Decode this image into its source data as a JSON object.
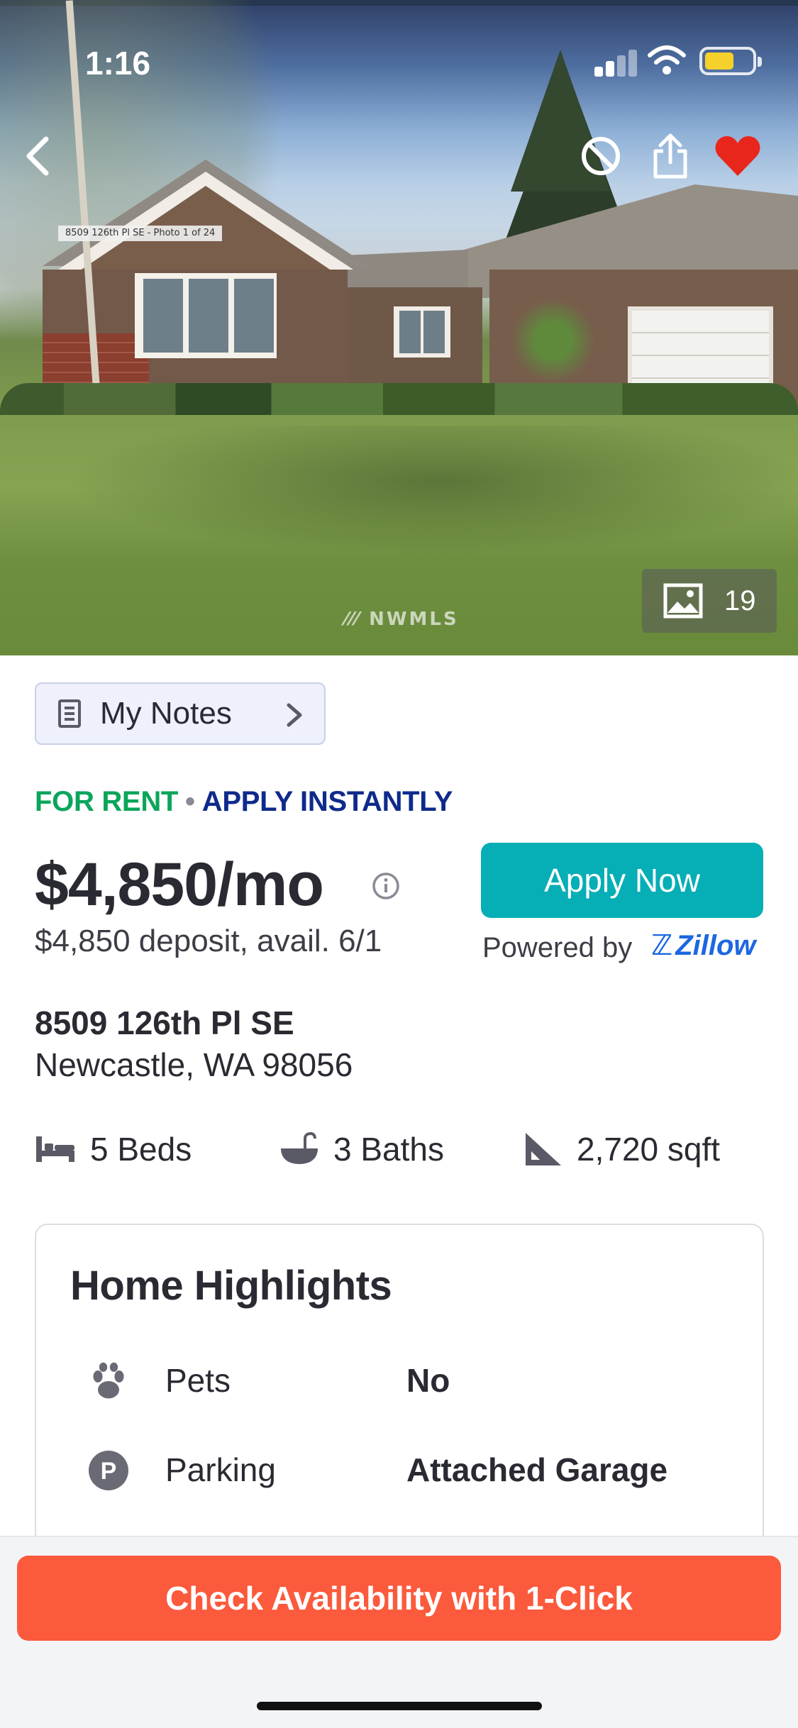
{
  "status_bar": {
    "time": "1:16"
  },
  "hero": {
    "photo_tag": "8509 126th Pl SE - Photo 1 of 24",
    "watermark": "NWMLS",
    "photo_count": "19"
  },
  "notes": {
    "label": "My Notes"
  },
  "listing": {
    "status": "FOR RENT",
    "separator": "•",
    "apply_tag": "APPLY INSTANTLY",
    "price": "$4,850/mo",
    "deposit": "$4,850 deposit, avail. 6/1",
    "apply_button": "Apply Now",
    "powered_by": "Powered by",
    "powered_brand": "Zillow",
    "address_line1": "8509 126th Pl SE",
    "address_line2": "Newcastle, WA 98056",
    "beds": "5 Beds",
    "baths": "3 Baths",
    "sqft": "2,720 sqft"
  },
  "highlights": {
    "title": "Home Highlights",
    "rows": [
      {
        "label": "Pets",
        "value": "No",
        "icon": "paw-icon"
      },
      {
        "label": "Parking",
        "value": "Attached Garage",
        "icon": "parking-icon"
      }
    ]
  },
  "cta": {
    "label": "Check Availability with 1-Click"
  },
  "colors": {
    "for_rent": "#0aa55b",
    "apply_instantly": "#0e2a8c",
    "apply_button": "#06aeb6",
    "zillow_blue": "#1d67e0",
    "cta": "#fb5a3c",
    "heart": "#e8261c"
  }
}
